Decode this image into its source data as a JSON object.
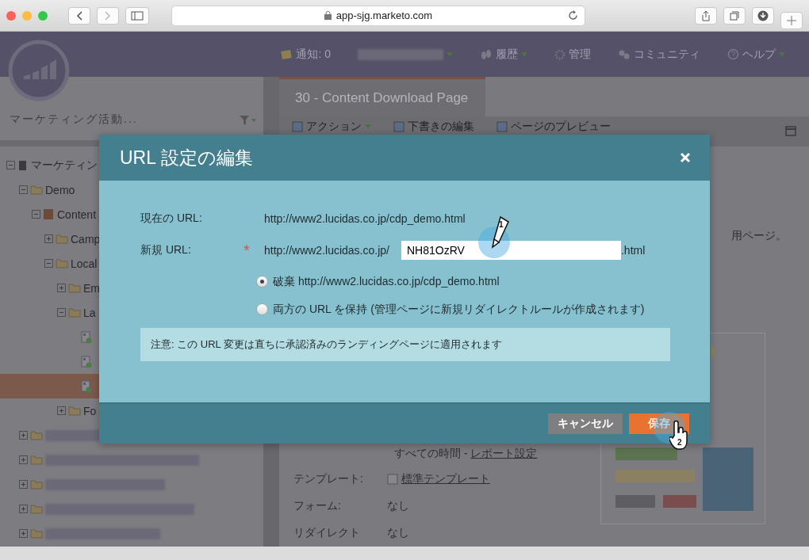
{
  "browser": {
    "address": "app-sjg.marketo.com"
  },
  "header": {
    "nav": [
      {
        "kind": "notes",
        "label": "通知: 0",
        "dropdown": false
      },
      {
        "kind": "redacted",
        "dropdown": true
      },
      {
        "kind": "history",
        "label": "履歴",
        "dropdown": true
      },
      {
        "kind": "admin",
        "label": "管理",
        "dropdown": false
      },
      {
        "kind": "community",
        "label": "コミュニティ",
        "dropdown": false
      },
      {
        "kind": "help",
        "label": "ヘルプ",
        "dropdown": true
      }
    ]
  },
  "sidebar": {
    "search": {
      "placeholder": "マーケティング活動..."
    },
    "tree": [
      {
        "kind": "root",
        "label": "マーケティン",
        "expanded": true,
        "children": [
          {
            "kind": "folder",
            "label": "Demo",
            "expanded": true,
            "children": [
              {
                "kind": "program",
                "label": "Content",
                "expanded": true,
                "children": [
                  {
                    "kind": "folder",
                    "label": "Camp",
                    "expanded": false
                  },
                  {
                    "kind": "folder",
                    "label": "Local",
                    "expanded": true,
                    "children": [
                      {
                        "kind": "folder",
                        "label": "Em",
                        "expanded": false
                      },
                      {
                        "kind": "folder",
                        "label": "La",
                        "expanded": true,
                        "children": [
                          {
                            "kind": "page",
                            "selected": false
                          },
                          {
                            "kind": "page",
                            "selected": false
                          },
                          {
                            "kind": "page",
                            "selected": true
                          }
                        ]
                      },
                      {
                        "kind": "folder",
                        "label": "Fo",
                        "expanded": false
                      }
                    ]
                  }
                ]
              }
            ]
          },
          {
            "kind": "redacted",
            "expanded": false
          },
          {
            "kind": "redacted",
            "expanded": false
          },
          {
            "kind": "redacted",
            "expanded": false
          },
          {
            "kind": "redacted",
            "expanded": false
          },
          {
            "kind": "redacted",
            "expanded": false
          }
        ]
      }
    ]
  },
  "tab": {
    "label": "30 - Content Download Page"
  },
  "toolbar": [
    {
      "label": "アクション",
      "dropdown": true
    },
    {
      "label": "下書きの編集",
      "dropdown": false
    },
    {
      "label": "ページのプレビュー",
      "dropdown": false
    }
  ],
  "content": {
    "heading": "用ページ。",
    "stats_line": "すべての時間 - ",
    "stats_link": "レポート設定",
    "fields": [
      {
        "label": "テンプレート:",
        "value": "標準テンプレート",
        "kind": "link"
      },
      {
        "label": "フォーム:",
        "value": "なし",
        "kind": "text"
      },
      {
        "label": "リダイレクト",
        "value": "なし",
        "kind": "text"
      }
    ]
  },
  "dialog": {
    "title": "URL 設定の編集",
    "current_label": "現在の URL:",
    "current_url": "http://www2.lucidas.co.jp/cdp_demo.html",
    "new_label": "新規 URL:",
    "required_mark": "*",
    "new_prefix": "http://www2.lucidas.co.jp/",
    "new_value": "NH81OzRV",
    "new_suffix": ".html",
    "options": [
      {
        "label": "破棄 http://www2.lucidas.co.jp/cdp_demo.html",
        "selected": true
      },
      {
        "label": "両方の URL を保持 (管理ページに新規リダイレクトルールが作成されます)",
        "selected": false
      }
    ],
    "note": "注意: この URL 変更は直ちに承認済みのランディングページに適用されます",
    "buttons": [
      {
        "kind": "cancel",
        "label": "キャンセル"
      },
      {
        "kind": "save",
        "label": "保存"
      }
    ]
  },
  "annotations": [
    {
      "kind": "pencil",
      "number": "1"
    },
    {
      "kind": "hand",
      "number": "2"
    }
  ]
}
